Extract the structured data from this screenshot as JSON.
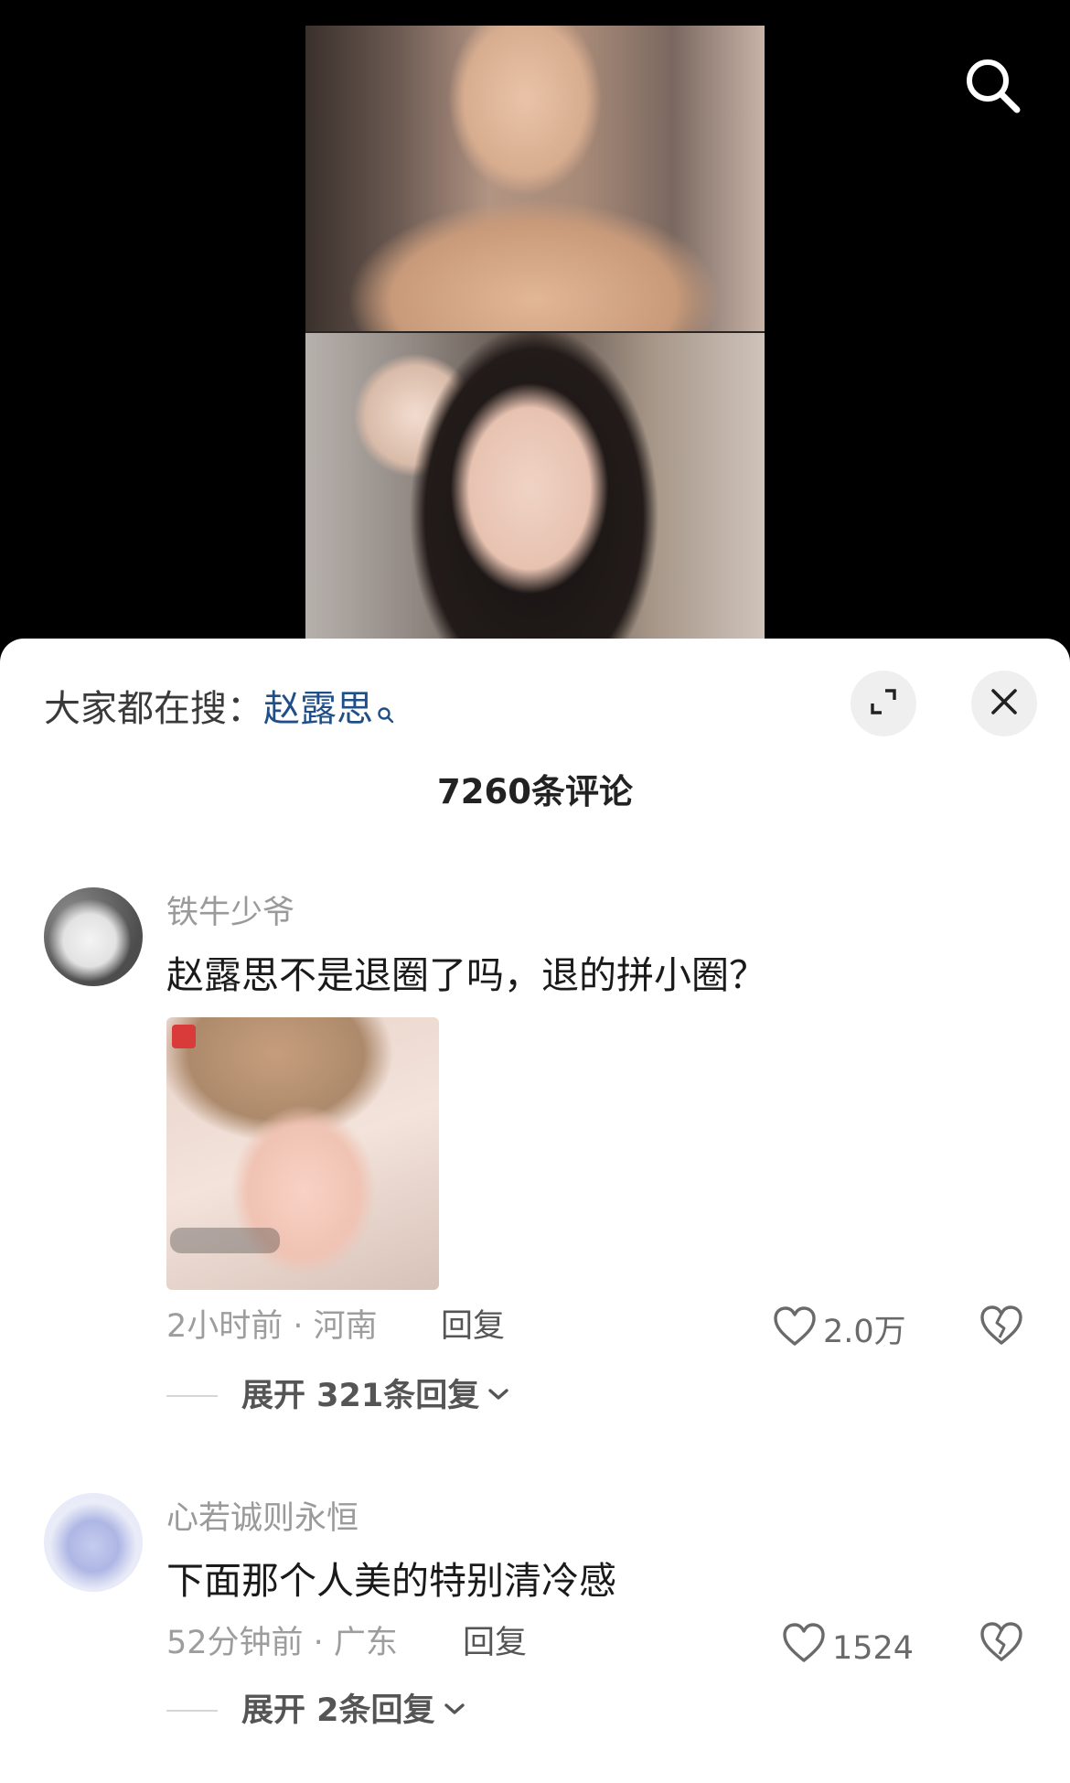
{
  "search": {
    "prefix": "大家都在搜：",
    "keyword": "赵露思"
  },
  "comments_header": {
    "count_label": "7260条评论"
  },
  "comments": [
    {
      "username": "铁牛少爷",
      "text": "赵露思不是退圈了吗，退的拼小圈？",
      "time_location": "2小时前 · 河南",
      "reply_label": "回复",
      "likes": "2.0万",
      "expand_label": "展开 321条回复",
      "has_image": true
    },
    {
      "username": "心若诚则永恒",
      "text": "下面那个人美的特别清冷感",
      "time_location": "52分钟前 · 广东",
      "reply_label": "回复",
      "likes": "1524",
      "expand_label": "展开 2条回复",
      "has_image": false
    }
  ],
  "icons": {
    "top_search": "search-icon",
    "keyword_search": "search-icon",
    "expand": "expand-icon",
    "close": "close-icon",
    "like": "heart-icon",
    "dislike": "broken-heart-icon",
    "chevron": "chevron-down-icon"
  },
  "colors": {
    "keyword": "#1f4f86",
    "sheet_background": "#ffffff",
    "video_background": "#000000"
  }
}
